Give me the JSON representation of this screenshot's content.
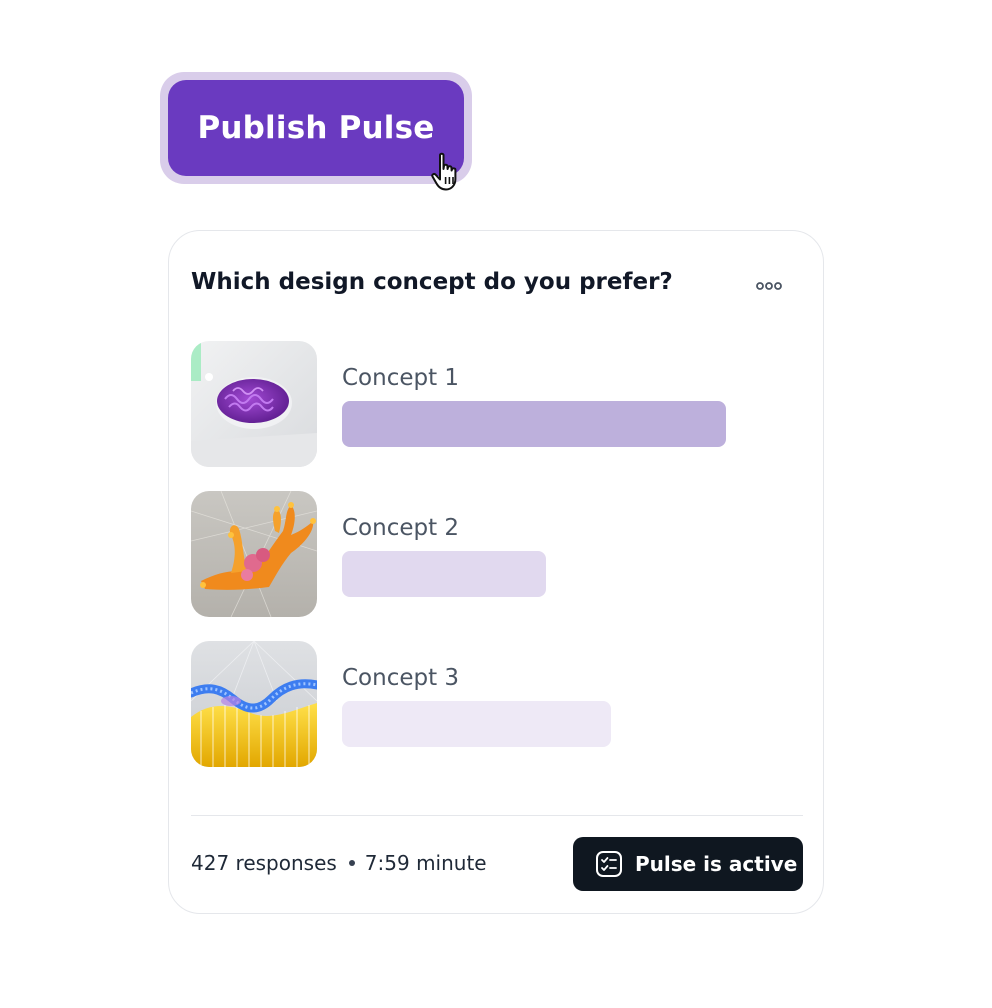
{
  "publish": {
    "label": "Publish Pulse"
  },
  "poll": {
    "question": "Which design concept do you prefer?",
    "options": [
      {
        "label": "Concept 1",
        "share": 1.0,
        "color": "#bdb0dc"
      },
      {
        "label": "Concept 2",
        "share": 0.53,
        "color": "#e1d9ef"
      },
      {
        "label": "Concept 3",
        "share": 0.7,
        "color": "#eee9f6"
      }
    ]
  },
  "footer": {
    "responses": "427 responses",
    "time": "7:59 minute",
    "status_label": "Pulse is active"
  },
  "icons": {
    "cursor": "hand-pointer-icon",
    "more": "more-horizontal-icon",
    "status": "checklist-icon"
  },
  "colors": {
    "brand": "#6a3ac0",
    "badge_bg": "#0f1720"
  }
}
